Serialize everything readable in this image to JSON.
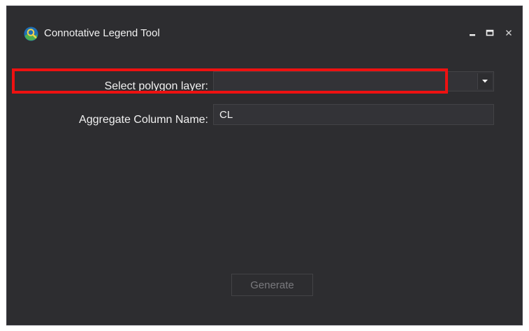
{
  "window": {
    "title": "Connotative Legend Tool",
    "background_color": "#2d2d30"
  },
  "titlebar_controls": {
    "minimize_icon": "minimize-icon",
    "maximize_icon": "maximize-icon",
    "close_icon": "close-icon"
  },
  "form": {
    "layer_label": "Select polygon layer:",
    "layer_value": "",
    "aggregate_label": "Aggregate Column Name:",
    "aggregate_value": "CL"
  },
  "actions": {
    "generate_label": "Generate",
    "generate_enabled": false
  },
  "annotation": {
    "highlight_color": "#ee1111"
  }
}
